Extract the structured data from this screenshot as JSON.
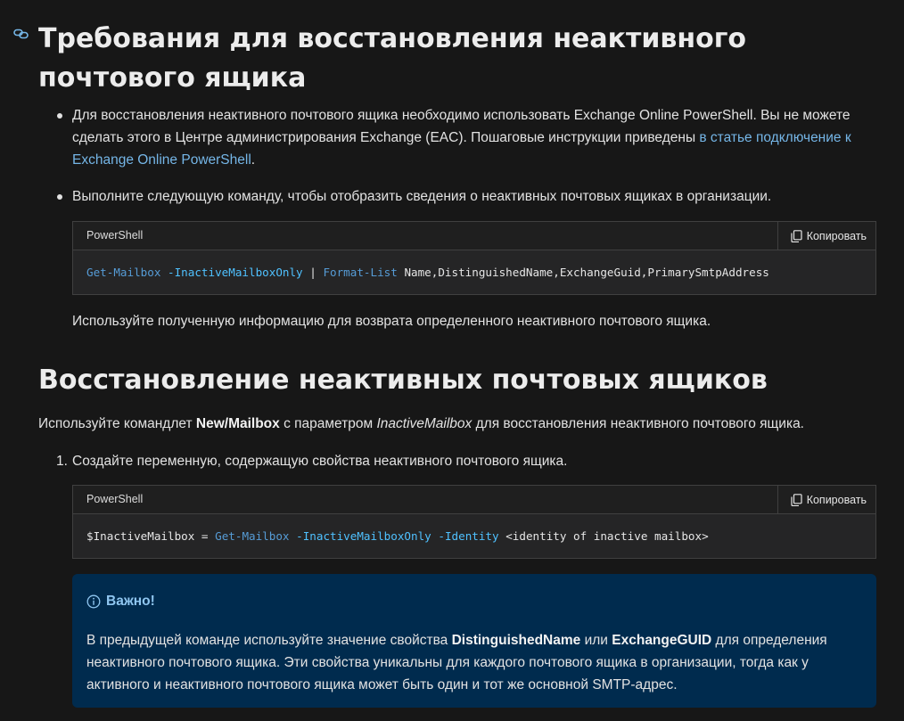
{
  "section1": {
    "heading": "Требования для восстановления неактивного почтового ящика",
    "bullet1": {
      "text_before_link": "Для восстановления неактивного почтового ящика необходимо использовать Exchange Online PowerShell. Вы не можете сделать этого в Центре администрирования Exchange (EAC). Пошаговые инструкции приведены ",
      "link": "в статье подключение к Exchange Online PowerShell",
      "text_after_link": "."
    },
    "bullet2": {
      "text": "Выполните следующую команду, чтобы отобразить сведения о неактивных почтовых ящиках в организации."
    },
    "code1": {
      "language": "PowerShell",
      "copy_label": "Копировать",
      "tokens": {
        "cmd1": "Get-Mailbox",
        "param1": "-InactiveMailboxOnly",
        "pipe": "|",
        "cmd2": "Format-List",
        "args": "Name,DistinguishedName,ExchangeGuid,PrimarySmtpAddress"
      }
    },
    "after_code_text": "Используйте полученную информацию для возврата определенного неактивного почтового ящика."
  },
  "section2": {
    "heading": "Восстановление неактивных почтовых ящиков",
    "intro": {
      "part1": "Используйте командлет ",
      "bold1": "New/Mailbox",
      "part2": " с параметром ",
      "italic1": "InactiveMailbox",
      "part3": " для восстановления неактивного почтового ящика."
    },
    "step1": {
      "marker": "1.",
      "text": "Создайте переменную, содержащую свойства неактивного почтового ящика."
    },
    "code2": {
      "language": "PowerShell",
      "copy_label": "Копировать",
      "tokens": {
        "var": "$InactiveMailbox",
        "eq": "=",
        "cmd1": "Get-Mailbox",
        "param1": "-InactiveMailboxOnly",
        "param2": "-Identity",
        "placeholder": "<identity of inactive mailbox>"
      }
    },
    "alert": {
      "title": "Важно!",
      "part1": "В предыдущей команде используйте значение свойства ",
      "bold1": "DistinguishedName",
      "part2": " или ",
      "bold2": "ExchangeGUID",
      "part3": " для определения неактивного почтового ящика. Эти свойства уникальны для каждого почтового ящика в организации, тогда как у активного и неактивного почтового ящика может быть один и тот же основной SMTP-адрес."
    }
  },
  "colors": {
    "background": "#171717",
    "link": "#75b6e7",
    "code_cmd": "#569cd6",
    "code_param": "#4fc1ff",
    "alert_bg": "#002b4e",
    "alert_title": "#8fc6f0"
  }
}
